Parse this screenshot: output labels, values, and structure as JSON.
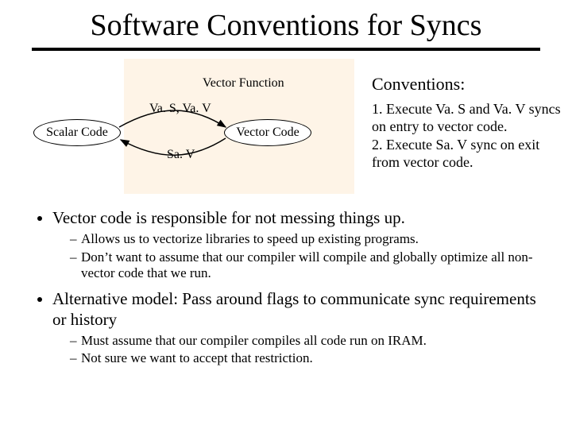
{
  "title": "Software Conventions for Syncs",
  "diagram": {
    "vector_function_label": "Vector Function",
    "scalar_label": "Scalar Code",
    "vector_label": "Vector Code",
    "sync_in": "Va. S, Va. V",
    "sync_out": "Sa. V"
  },
  "conventions": {
    "header": "Conventions:",
    "line1": "1. Execute Va. S and Va. V syncs on entry to vector code.",
    "line2": "2. Execute Sa. V sync on exit from vector code."
  },
  "bullets": {
    "b1": "Vector code is responsible for not messing things up.",
    "b1a": "Allows us to vectorize libraries to speed up existing programs.",
    "b1b": "Don’t want to assume that our compiler will compile and globally optimize all non-vector code that we run.",
    "b2": "Alternative model: Pass around flags to communicate sync requirements or history",
    "b2a": "Must assume that our compiler compiles all code run on IRAM.",
    "b2b": "Not sure we want to accept that restriction."
  }
}
